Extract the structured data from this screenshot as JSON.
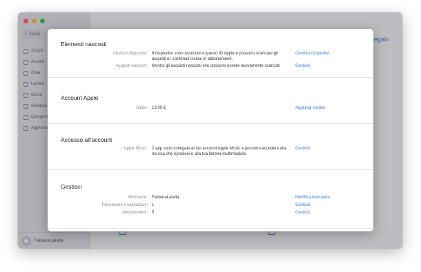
{
  "window": {
    "sidebar": {
      "search_placeholder": "Cerca",
      "items": [
        "Scopri",
        "Arcade",
        "Crea",
        "Lavora",
        "Gioca",
        "Sviluppa",
        "Categorie",
        "Aggiornamenti"
      ],
      "account_name": "Fabiana Latella"
    },
    "main": {
      "top_right_link": "regalo"
    }
  },
  "sheet": {
    "elementi_nascosti": {
      "title": "Elementi nascosti",
      "rows": [
        {
          "label": "Gestisci dispositivi:",
          "value": "6 dispositivi sono associati a questo ID Apple e possono scaricare gli acquisti o i contenuti inclusi in abbonamenti.",
          "action": "Gestisci dispositivi"
        },
        {
          "label": "Acquisti nascosti:",
          "value": "Mostra gli acquisti nascosti che possono essere nuovamente scaricati",
          "action": "Gestisci"
        }
      ]
    },
    "account_apple": {
      "title": "Account Apple",
      "rows": [
        {
          "label": "Saldo:",
          "value": "13,00 €",
          "action": "Aggiungi credito"
        }
      ]
    },
    "accesso_account": {
      "title": "Accesso all'account",
      "rows": [
        {
          "label": "Apple Music:",
          "value": "2 app sono collegate al tuo account Apple Music e possono accedere alla musica che riproduci e alla tua libreria multimediale.",
          "action": "Gestisci"
        }
      ]
    },
    "gestisci": {
      "title": "Gestisci",
      "rows": [
        {
          "label": "Nickname:",
          "value": "FabianaLatella",
          "action": "Modifica nickname"
        },
        {
          "label": "Recensioni e valutazioni:",
          "value": "1",
          "action": "Gestisci"
        },
        {
          "label": "Abbonamenti:",
          "value": "5",
          "action": "Gestisci"
        }
      ]
    }
  },
  "colors": {
    "accent": "#2d7bd6",
    "label_gray": "#8a8a8e"
  }
}
